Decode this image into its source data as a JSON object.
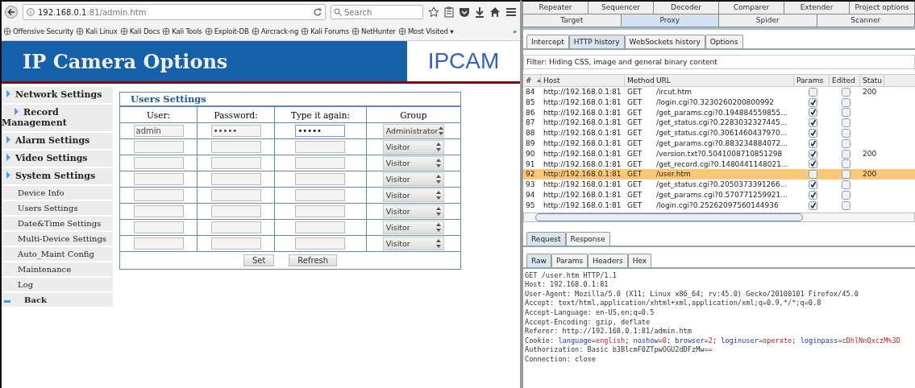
{
  "browser": {
    "url_host": "192.168.0.1",
    "url_rest": ":81/admin.htm",
    "search": {
      "placeholder": "Search"
    },
    "bookmarks": [
      "Offensive Security",
      "Kali Linux",
      "Kali Docs",
      "Kali Tools",
      "Exploit-DB",
      "Aircrack-ng",
      "Kali Forums",
      "NetHunter",
      "Most Visited ▾"
    ],
    "overflow": "»"
  },
  "page": {
    "title": "IP Camera Options",
    "logo": "IPCAM",
    "sidebar": [
      {
        "kind": "section",
        "label": "Network Settings"
      },
      {
        "kind": "section",
        "label": "Record Management"
      },
      {
        "kind": "section",
        "label": "Alarm Settings"
      },
      {
        "kind": "section",
        "label": "Video Settings"
      },
      {
        "kind": "section",
        "label": "System Settings"
      },
      {
        "kind": "sub",
        "label": "Device Info"
      },
      {
        "kind": "sub",
        "label": "Users Settings"
      },
      {
        "kind": "sub",
        "label": "Date&Time Settings"
      },
      {
        "kind": "sub",
        "label": "Multi-Device Settings"
      },
      {
        "kind": "sub",
        "label": "Auto_Maint Config"
      },
      {
        "kind": "sub",
        "label": "Maintenance"
      },
      {
        "kind": "sub",
        "label": "Log"
      },
      {
        "kind": "back",
        "label": "Back"
      }
    ],
    "users": {
      "title": "Users Settings",
      "columns": [
        "User:",
        "Password:",
        "Type it again:",
        "Group"
      ],
      "rows": [
        {
          "user": "admin",
          "password": "•••••",
          "confirm": "•••••",
          "confirm_focused": true,
          "group": "Administrator"
        },
        {
          "user": "",
          "password": "",
          "confirm": "",
          "confirm_focused": false,
          "group": "Visitor"
        },
        {
          "user": "",
          "password": "",
          "confirm": "",
          "confirm_focused": false,
          "group": "Visitor"
        },
        {
          "user": "",
          "password": "",
          "confirm": "",
          "confirm_focused": false,
          "group": "Visitor"
        },
        {
          "user": "",
          "password": "",
          "confirm": "",
          "confirm_focused": false,
          "group": "Visitor"
        },
        {
          "user": "",
          "password": "",
          "confirm": "",
          "confirm_focused": false,
          "group": "Visitor"
        },
        {
          "user": "",
          "password": "",
          "confirm": "",
          "confirm_focused": false,
          "group": "Visitor"
        },
        {
          "user": "",
          "password": "",
          "confirm": "",
          "confirm_focused": false,
          "group": "Visitor"
        }
      ],
      "buttons": [
        "Set",
        "Refresh"
      ]
    }
  },
  "burp": {
    "tabs_top": [
      {
        "label": "Repeater",
        "selected": false
      },
      {
        "label": "Sequencer",
        "selected": false
      },
      {
        "label": "Decoder",
        "selected": false
      },
      {
        "label": "Comparer",
        "selected": false
      },
      {
        "label": "Extender",
        "selected": false
      },
      {
        "label": "Project options",
        "selected": false
      }
    ],
    "tabs_main": [
      {
        "label": "Target",
        "selected": false
      },
      {
        "label": "Proxy",
        "selected": true
      },
      {
        "label": "Spider",
        "selected": false
      },
      {
        "label": "Scanner",
        "selected": false
      }
    ],
    "proxy_tabs": [
      {
        "label": "Intercept",
        "selected": false
      },
      {
        "label": "HTTP history",
        "selected": true
      },
      {
        "label": "WebSockets history",
        "selected": false
      },
      {
        "label": "Options",
        "selected": false
      }
    ],
    "filter": "Filter: Hiding CSS, image and general binary content",
    "history": {
      "columns": [
        "#",
        "Host",
        "Method",
        "URL",
        "Params",
        "Edited",
        "Statu"
      ],
      "rows": [
        {
          "num": "84",
          "host": "http://192.168.0.1:81",
          "method": "GET",
          "url": "/ircut.htm",
          "params": false,
          "edited": false,
          "status": "200",
          "selected": false
        },
        {
          "num": "85",
          "host": "http://192.168.0.1:81",
          "method": "GET",
          "url": "/login.cgi?0.3230260200800992",
          "params": true,
          "edited": false,
          "status": "",
          "selected": false
        },
        {
          "num": "86",
          "host": "http://192.168.0.1:81",
          "method": "GET",
          "url": "/get_params.cgi?0.194884559855...",
          "params": true,
          "edited": false,
          "status": "",
          "selected": false
        },
        {
          "num": "87",
          "host": "http://192.168.0.1:81",
          "method": "GET",
          "url": "/get_status.cgi?0.2283032327445...",
          "params": true,
          "edited": false,
          "status": "",
          "selected": false
        },
        {
          "num": "88",
          "host": "http://192.168.0.1:81",
          "method": "GET",
          "url": "/get_status.cgi?0.3061460437970...",
          "params": true,
          "edited": false,
          "status": "",
          "selected": false
        },
        {
          "num": "89",
          "host": "http://192.168.0.1:81",
          "method": "GET",
          "url": "/get_params.cgi?0.883234884072...",
          "params": true,
          "edited": false,
          "status": "",
          "selected": false
        },
        {
          "num": "90",
          "host": "http://192.168.0.1:81",
          "method": "GET",
          "url": "/version.txt?0.5041008710851298",
          "params": true,
          "edited": false,
          "status": "200",
          "selected": false
        },
        {
          "num": "91",
          "host": "http://192.168.0.1:81",
          "method": "GET",
          "url": "/get_record.cgi?0.1480441148021...",
          "params": true,
          "edited": false,
          "status": "",
          "selected": false
        },
        {
          "num": "92",
          "host": "http://192.168.0.1:81",
          "method": "GET",
          "url": "/user.htm",
          "params": false,
          "edited": false,
          "status": "200",
          "selected": true
        },
        {
          "num": "93",
          "host": "http://192.168.0.1:81",
          "method": "GET",
          "url": "/get_status.cgi?0.2050373391266...",
          "params": true,
          "edited": false,
          "status": "",
          "selected": false
        },
        {
          "num": "94",
          "host": "http://192.168.0.1:81",
          "method": "GET",
          "url": "/get_params.cgi?0.570771259921...",
          "params": true,
          "edited": false,
          "status": "",
          "selected": false
        },
        {
          "num": "95",
          "host": "http://192.168.0.1:81",
          "method": "GET",
          "url": "/login.cgi?0.25262097560144936",
          "params": true,
          "edited": false,
          "status": "",
          "selected": false
        }
      ]
    },
    "message_tabs": [
      {
        "label": "Request",
        "selected": true
      },
      {
        "label": "Response",
        "selected": false
      }
    ],
    "view_tabs": [
      {
        "label": "Raw",
        "selected": true
      },
      {
        "label": "Params",
        "selected": false
      },
      {
        "label": "Headers",
        "selected": false
      },
      {
        "label": "Hex",
        "selected": false
      }
    ],
    "request": [
      [
        {
          "kind": "plain",
          "text": "GET /user.htm HTTP/1.1"
        }
      ],
      [
        {
          "kind": "plain",
          "text": "Host: 192.168.0.1:81"
        }
      ],
      [
        {
          "kind": "plain",
          "text": "User-Agent: Mozilla/5.0 (X11; Linux x86_64; rv:45.0) Gecko/20100101 Firefox/45.0"
        }
      ],
      [
        {
          "kind": "plain",
          "text": "Accept: text/html,application/xhtml+xml,application/xml;q=0.9,*/*;q=0.8"
        }
      ],
      [
        {
          "kind": "plain",
          "text": "Accept-Language: en-US,en;q=0.5"
        }
      ],
      [
        {
          "kind": "plain",
          "text": "Accept-Encoding: gzip, deflate"
        }
      ],
      [
        {
          "kind": "plain",
          "text": "Referer: http://192.168.0.1:81/admin.htm"
        }
      ],
      [
        {
          "kind": "plain",
          "text": "Cookie: "
        },
        {
          "kind": "key",
          "text": "language"
        },
        {
          "kind": "plain",
          "text": "="
        },
        {
          "kind": "value",
          "text": "english"
        },
        {
          "kind": "plain",
          "text": "; "
        },
        {
          "kind": "key",
          "text": "noshow"
        },
        {
          "kind": "plain",
          "text": "="
        },
        {
          "kind": "value",
          "text": "0"
        },
        {
          "kind": "plain",
          "text": "; "
        },
        {
          "kind": "key",
          "text": "browser"
        },
        {
          "kind": "plain",
          "text": "="
        },
        {
          "kind": "value",
          "text": "2"
        },
        {
          "kind": "plain",
          "text": "; "
        },
        {
          "kind": "key",
          "text": "loginuser"
        },
        {
          "kind": "plain",
          "text": "="
        },
        {
          "kind": "value",
          "text": "operate"
        },
        {
          "kind": "plain",
          "text": "; "
        },
        {
          "kind": "key",
          "text": "loginpass"
        },
        {
          "kind": "plain",
          "text": "="
        },
        {
          "kind": "value",
          "text": "cDhlNnQxczM%3D"
        }
      ],
      [
        {
          "kind": "plain",
          "text": "Authorization: Basic b3BlcmF0ZTpwOGU2dDFzMw=="
        }
      ],
      [
        {
          "kind": "plain",
          "text": "Connection: close"
        }
      ]
    ]
  }
}
